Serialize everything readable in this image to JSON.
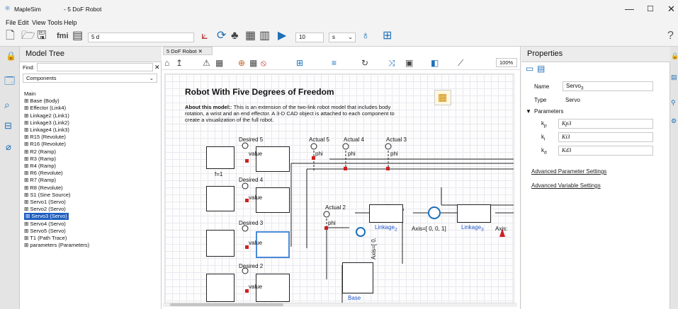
{
  "window": {
    "app_name": "MapleSim",
    "doc_title": "- 5 DoF Robot",
    "min": "—",
    "max": "☐",
    "close": "✕"
  },
  "menu": [
    "File",
    "Edit",
    "View",
    "Tools",
    "Help"
  ],
  "toolbar": {
    "path_field": "5 d",
    "time_value": "10",
    "time_unit": "s"
  },
  "tree": {
    "title": "Model Tree",
    "find_label": "Find:",
    "filter": "Components",
    "clear": "✕",
    "items": [
      "Main",
      "Base (Body)",
      "Effector (Link4)",
      "Linkage2 (Link1)",
      "Linkage3 (Link2)",
      "Linkage4 (Link3)",
      "R15 (Revolute)",
      "R16 (Revolute)",
      "R2 (Ramp)",
      "R3 (Ramp)",
      "R4 (Ramp)",
      "R6 (Revolute)",
      "R7 (Ramp)",
      "R8 (Revolute)",
      "S1 (Sine Source)",
      "Servo1 (Servo)",
      "Servo2 (Servo)",
      "Servo3 (Servo)",
      "Servo4 (Servo)",
      "Servo5 (Servo)",
      "T1 (Path Trace)",
      "parameters (Parameters)"
    ],
    "selected": "Servo3 (Servo)"
  },
  "tab": {
    "label": "5 DoF Robot",
    "close": "✕",
    "zoom": "100%"
  },
  "model": {
    "title": "Robot With Five Degrees of Freedom",
    "about_label": "About this model:",
    "about_text": ": This is an extension of the two-link robot model that includes body rotation, a wrist and an end effector. A 3-D CAD object is attached to each component to create a visualization of the full robot.",
    "desired": [
      "Desired 5",
      "Desired 4",
      "Desired 3",
      "Desired 2"
    ],
    "actual": [
      "Actual 5",
      "Actual 4",
      "Actual 3",
      "Actual 2"
    ],
    "value": "value",
    "phi": "phi",
    "f1": "f=1",
    "linkage2": "Linkage",
    "linkage2_sub": "2",
    "linkage3": "Linkage",
    "linkage3_sub": "3",
    "axis_text": "Axis=[ 0, 0, 1]",
    "axis_vert": "Axis=[ 0,",
    "axis_short": "Axis:",
    "base": "Base"
  },
  "props": {
    "title": "Properties",
    "name_label": "Name",
    "name_value": "Servo",
    "name_sub": "3",
    "type_label": "Type",
    "type_value": "Servo",
    "params_label": "Parameters",
    "params": [
      {
        "sym": "k",
        "sub": "p",
        "val": "Kp3"
      },
      {
        "sym": "k",
        "sub": "i",
        "val": "Ki3"
      },
      {
        "sym": "k",
        "sub": "d",
        "val": "Kd3"
      }
    ],
    "adv_param": "Advanced Parameter Settings",
    "adv_var": "Advanced Variable Settings"
  }
}
